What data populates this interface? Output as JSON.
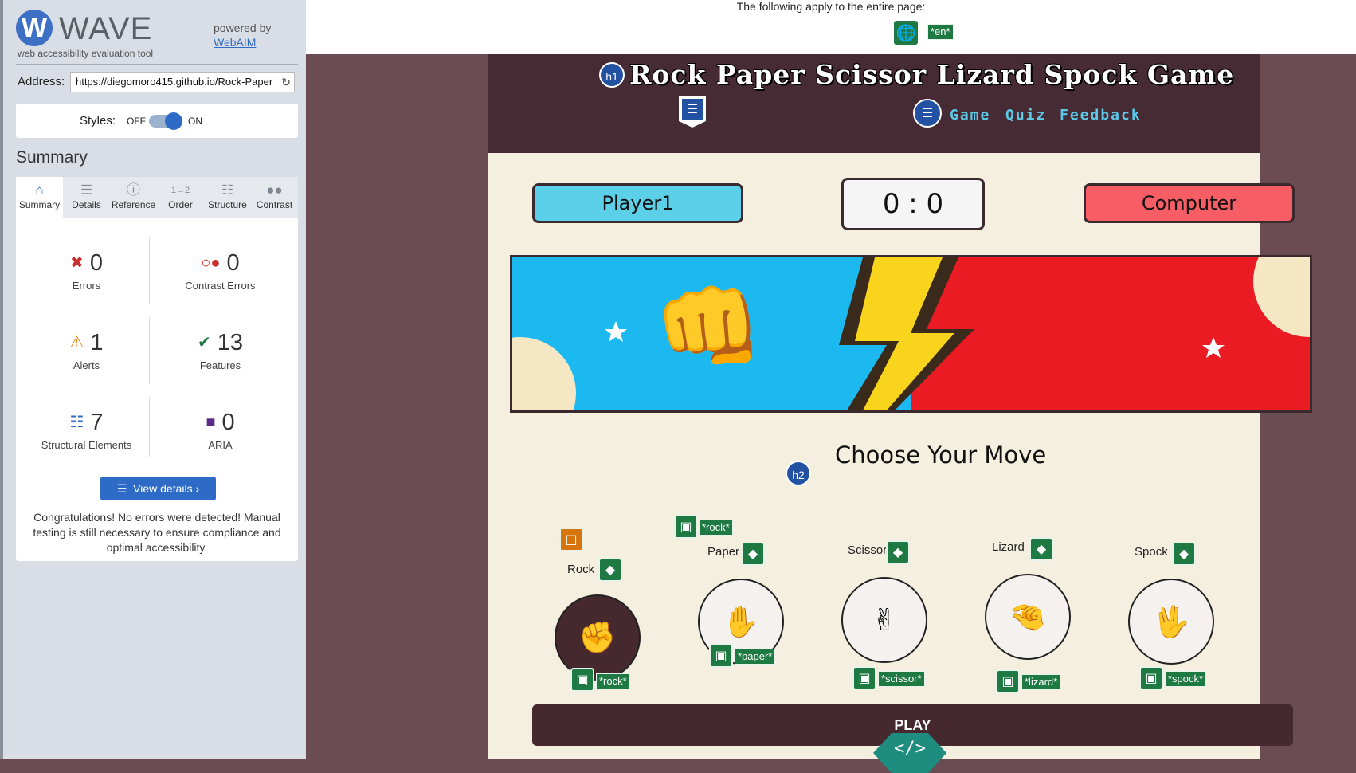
{
  "wave": {
    "logo_letter": "W",
    "title": "WAVE",
    "subtitle": "web accessibility evaluation tool",
    "powered_by": "powered by",
    "powered_link": "WebAIM",
    "address_label": "Address:",
    "address_value": "https://diegomoro415.github.io/Rock-Paper",
    "styles_label": "Styles:",
    "styles_off": "OFF",
    "styles_on": "ON",
    "styles_state": "on",
    "summary_heading": "Summary",
    "tabs": [
      {
        "label": "Summary",
        "icon": "home-icon"
      },
      {
        "label": "Details",
        "icon": "list-icon"
      },
      {
        "label": "Reference",
        "icon": "info-icon"
      },
      {
        "label": "Order",
        "icon": "order-icon"
      },
      {
        "label": "Structure",
        "icon": "structure-icon"
      },
      {
        "label": "Contrast",
        "icon": "contrast-icon"
      }
    ],
    "stats": {
      "errors": {
        "value": "0",
        "label": "Errors"
      },
      "contrast_errors": {
        "value": "0",
        "label": "Contrast Errors"
      },
      "alerts": {
        "value": "1",
        "label": "Alerts"
      },
      "features": {
        "value": "13",
        "label": "Features"
      },
      "structural": {
        "value": "7",
        "label": "Structural Elements"
      },
      "aria": {
        "value": "0",
        "label": "ARIA"
      }
    },
    "view_details": "View details ›",
    "congrats": "Congratulations! No errors were detected! Manual testing is still necessary to ensure compliance and optimal accessibility."
  },
  "page": {
    "applies_text": "The following apply to the entire page:",
    "lang_tag": "*en*",
    "h1_badge": "h1",
    "h2_badge": "h2",
    "title": "Rock Paper Scissor Lizard Spock Game",
    "nav": [
      "Game",
      "Quiz",
      "Feedback"
    ],
    "player_label": "Player1",
    "score": "0 : 0",
    "computer_label": "Computer",
    "choose_heading": "Choose Your Move",
    "moves": [
      {
        "label": "Rock",
        "alt_tag": "*rock*",
        "emoji": "✊",
        "selected": true
      },
      {
        "label": "Paper",
        "alt_tag": "*paper*",
        "emoji": "✋",
        "selected": false
      },
      {
        "label": "Scissor",
        "alt_tag": "*scissor*",
        "emoji": "✌",
        "selected": false
      },
      {
        "label": "Lizard",
        "alt_tag": "*lizard*",
        "emoji": "🤏",
        "selected": false
      },
      {
        "label": "Spock",
        "alt_tag": "*spock*",
        "emoji": "🖖",
        "selected": false
      }
    ],
    "banner_alt_tag": "*rock*",
    "play_label": "PLAY",
    "code_badge": "</>"
  },
  "colors": {
    "wave_blue": "#2e6bc6",
    "wave_green": "#1e7a42",
    "header_bg": "#462a34",
    "game_bg": "#f5efe0",
    "player_color": "#5bd0e8",
    "computer_color": "#f75d64",
    "nav_color": "#5bc9e8"
  }
}
